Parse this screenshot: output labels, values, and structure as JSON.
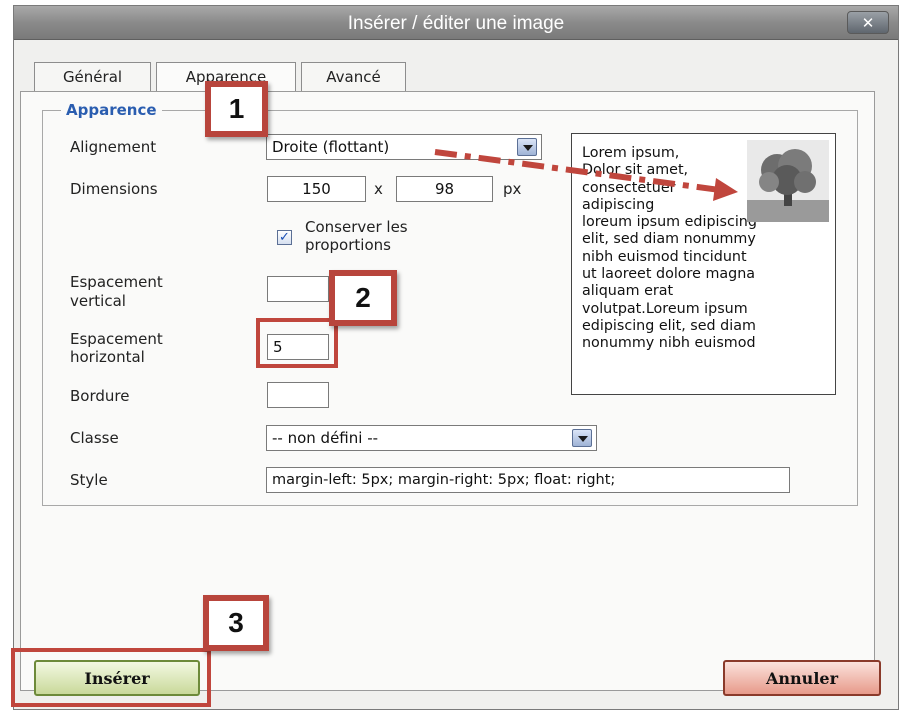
{
  "window": {
    "title": "Insérer / éditer une image",
    "close_label": "✕"
  },
  "tabs": [
    {
      "label": "Général",
      "active": false
    },
    {
      "label": "Apparence",
      "active": true
    },
    {
      "label": "Avancé",
      "active": false
    }
  ],
  "section": {
    "legend": "Apparence"
  },
  "form": {
    "alignement": {
      "label": "Alignement",
      "value": "Droite (flottant)"
    },
    "dimensions": {
      "label": "Dimensions",
      "width": "150",
      "separator": "x",
      "height": "98",
      "unit": "px"
    },
    "conserver": {
      "label_line1": "Conserver les",
      "label_line2": "proportions",
      "checked": true,
      "check_glyph": "✓"
    },
    "espacement_vertical": {
      "label_line1": "Espacement",
      "label_line2": "vertical",
      "value": ""
    },
    "espacement_horizontal": {
      "label_line1": "Espacement",
      "label_line2": "horizontal",
      "value": "5"
    },
    "bordure": {
      "label": "Bordure",
      "value": ""
    },
    "classe": {
      "label": "Classe",
      "value": "-- non défini --"
    },
    "style": {
      "label": "Style",
      "value": "margin-left: 5px; margin-right: 5px; float: right;"
    }
  },
  "preview": {
    "lines": [
      "Lorem ipsum,",
      "Dolor sit amet,",
      "consectetuer",
      "adipiscing",
      "loreum ipsum edipiscing",
      "elit, sed diam nonummy",
      "nibh euismod tincidunt",
      "ut laoreet dolore magna",
      "aliquam erat",
      "volutpat.Loreum ipsum",
      "edipiscing elit, sed diam",
      "nonummy nibh euismod"
    ],
    "image_icon": "tree-image-icon"
  },
  "buttons": {
    "insert": "Insérer",
    "cancel": "Annuler"
  },
  "annotations": {
    "badge1": "1",
    "badge2": "2",
    "badge3": "3"
  },
  "colors": {
    "callout": "#c0463d",
    "legend": "#2a5db0",
    "insert_button": "#c9d99a",
    "cancel_button": "#e79a8a"
  }
}
